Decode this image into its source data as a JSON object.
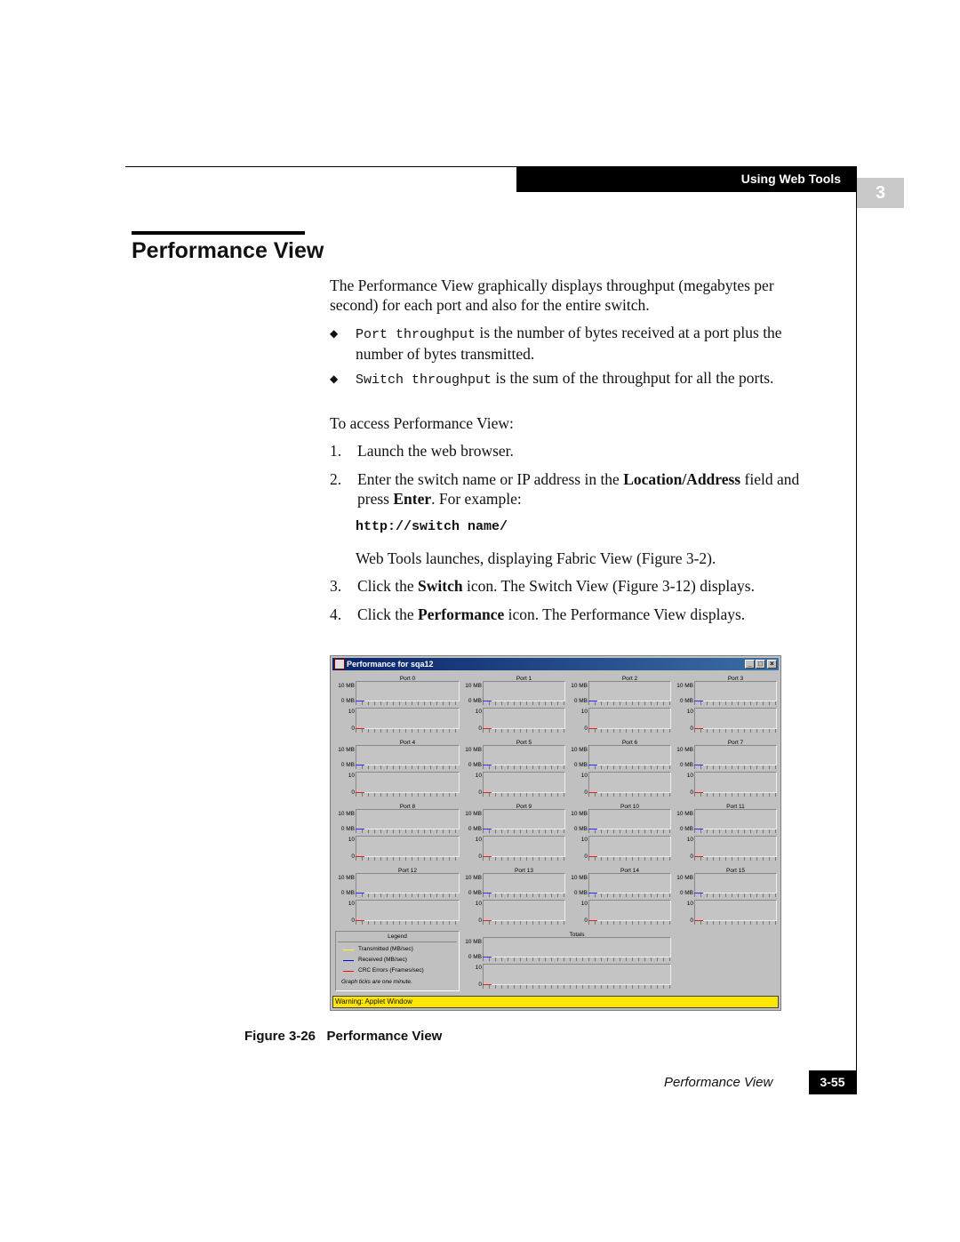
{
  "header": {
    "section": "Using Web Tools",
    "chapter": "3"
  },
  "title": "Performance View",
  "intro": "The Performance View graphically displays throughput (megabytes per second) for each port and also for the entire switch.",
  "bullets": [
    {
      "code": "Port throughput",
      "text": " is the number of bytes received at a port plus the number of bytes transmitted."
    },
    {
      "code": "Switch throughput",
      "text": " is the sum of the throughput for all the ports."
    }
  ],
  "access": "To access Performance View:",
  "steps": [
    {
      "n": "1.",
      "parts": [
        {
          "t": "Launch the web browser."
        }
      ]
    },
    {
      "n": "2.",
      "parts": [
        {
          "t": "Enter the switch name or IP address in the "
        },
        {
          "t": "Location/Address",
          "b": true
        },
        {
          "t": " field and press "
        },
        {
          "t": "Enter",
          "b": true
        },
        {
          "t": ". For example:"
        }
      ]
    },
    {
      "n": "3.",
      "parts": [
        {
          "t": "Click the "
        },
        {
          "t": "Switch",
          "b": true
        },
        {
          "t": " icon. The Switch View (Figure 3-12) displays."
        }
      ]
    },
    {
      "n": "4.",
      "parts": [
        {
          "t": "Click the "
        },
        {
          "t": "Performance",
          "b": true
        },
        {
          "t": " icon. The Performance View displays."
        }
      ]
    }
  ],
  "example_url": "http://switch name/",
  "launch_note": "Web Tools launches, displaying Fabric View (Figure 3-2).",
  "window": {
    "title": "Performance for sqa12",
    "ports": [
      "Port 0",
      "Port 1",
      "Port 2",
      "Port 3",
      "Port 4",
      "Port 5",
      "Port 6",
      "Port 7",
      "Port 8",
      "Port 9",
      "Port 10",
      "Port 11",
      "Port 12",
      "Port 13",
      "Port 14",
      "Port 15"
    ],
    "axis": {
      "mb_top": "10 MB",
      "mb_bottom": "0 MB",
      "crc_top": "10",
      "crc_bottom": "0"
    },
    "totals_label": "Totals",
    "legend": {
      "title": "Legend",
      "items": [
        {
          "label": "Transmitted (MB/sec)",
          "color": "#ffff00"
        },
        {
          "label": "Received (MB/sec)",
          "color": "#0000ff"
        },
        {
          "label": "CRC Errors (Frames/sec)",
          "color": "#ff0000"
        }
      ],
      "note": "Graph ticks are one minute."
    },
    "warning": "Warning: Applet Window"
  },
  "caption": {
    "number": "Figure 3-26",
    "title": "Performance View"
  },
  "footer": {
    "title": "Performance View",
    "page": "3-55"
  }
}
